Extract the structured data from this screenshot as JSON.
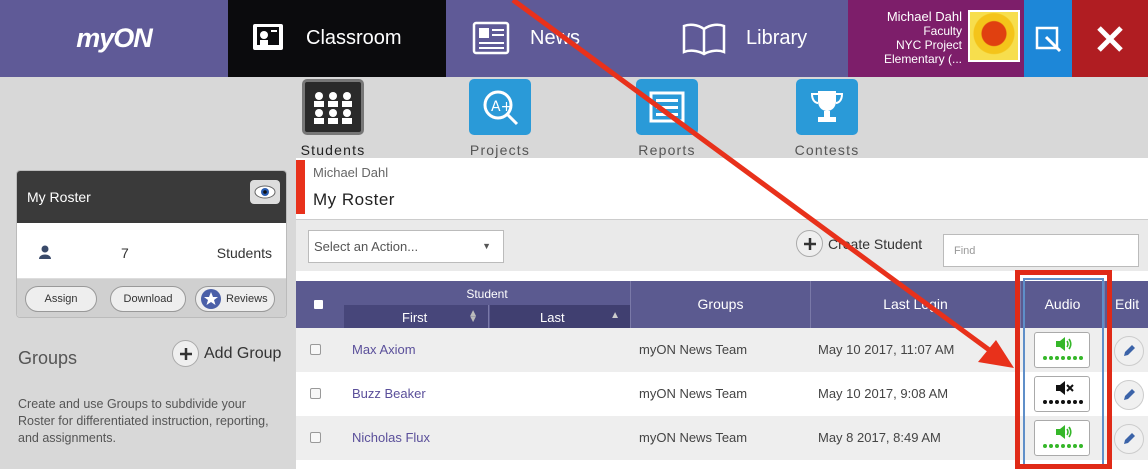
{
  "app": {
    "logo": "myON"
  },
  "nav": {
    "tabs": [
      {
        "label": "Classroom",
        "active": true
      },
      {
        "label": "News",
        "active": false
      },
      {
        "label": "Library",
        "active": false
      }
    ],
    "user": {
      "name": "Michael Dahl",
      "role": "Faculty",
      "school": "NYC Project Elementary (..."
    }
  },
  "subnav": {
    "items": [
      {
        "label": "Students",
        "icon": "students-icon",
        "active": true
      },
      {
        "label": "Projects",
        "icon": "projects-icon"
      },
      {
        "label": "Reports",
        "icon": "reports-icon"
      },
      {
        "label": "Contests",
        "icon": "contests-icon"
      }
    ]
  },
  "sidebar": {
    "roster_title": "My Roster",
    "student_count": "7",
    "students_label": "Students",
    "buttons": {
      "assign": "Assign",
      "download": "Download",
      "reviews": "Reviews"
    },
    "groups_title": "Groups",
    "add_group": "Add Group",
    "groups_desc": "Create and use Groups to subdivide your Roster for differentiated instruction, reporting, and assignments."
  },
  "main": {
    "breadcrumb": "Michael Dahl",
    "title": "My Roster",
    "action_placeholder": "Select an Action...",
    "create_student": "Create Student",
    "find_placeholder": "Find",
    "columns": {
      "student": "Student",
      "first": "First",
      "last": "Last",
      "groups": "Groups",
      "last_login": "Last Login",
      "audio": "Audio",
      "edit": "Edit"
    },
    "rows": [
      {
        "first": "Max Axiom",
        "last": "",
        "group": "myON News Team",
        "last_login": "May 10 2017, 11:07 AM",
        "audio": "on"
      },
      {
        "first": "Buzz Beaker",
        "last": "",
        "group": "myON News Team",
        "last_login": "May 10 2017, 9:08 AM",
        "audio": "muted"
      },
      {
        "first": "Nicholas Flux",
        "last": "",
        "group": "myON News Team",
        "last_login": "May 8 2017, 8:49 AM",
        "audio": "on"
      }
    ]
  },
  "colors": {
    "nav_purple": "#5f5a97",
    "active_tab": "#0b0b0d",
    "user_block": "#7d1e6a",
    "annotation_red": "#e02a17",
    "audio_green": "#35b729"
  }
}
